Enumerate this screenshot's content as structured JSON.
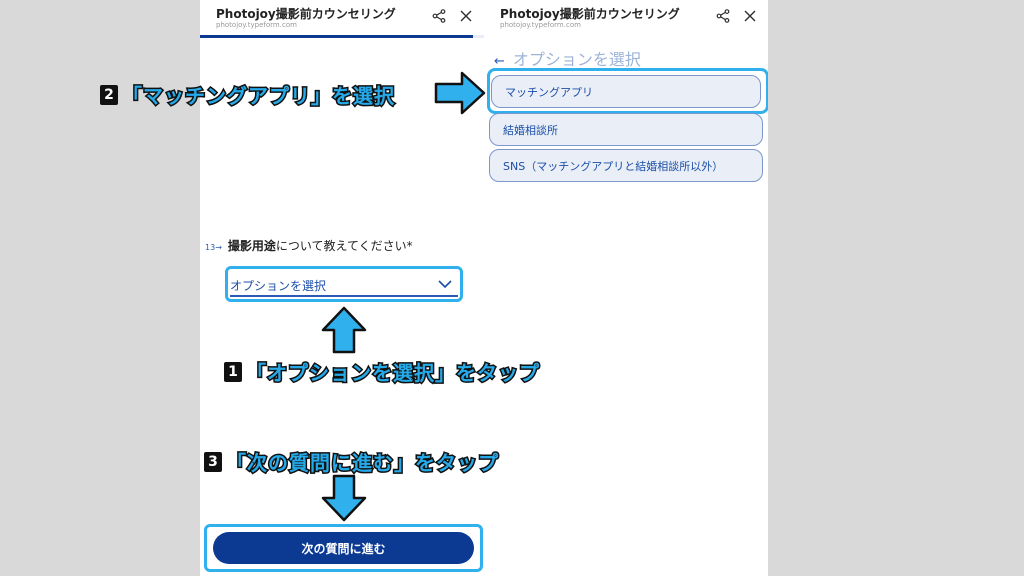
{
  "app": {
    "title": "Photojoy撮影前カウンセリング",
    "url": "photojoy.typeform.com",
    "share_icon": "share-icon",
    "close_icon": "close-icon"
  },
  "left": {
    "progress": 0.96,
    "question": {
      "number": "13",
      "arrow": "→",
      "bold": "撮影用途",
      "rest": "について教えてください*"
    },
    "dropdown": {
      "placeholder": "オプションを選択",
      "icon": "chevron-down-icon"
    },
    "next_button": "次の質問に進む"
  },
  "right": {
    "back_arrow": "←",
    "back_label": "オプションを選択",
    "options": [
      "マッチングアプリ",
      "結婚相談所",
      "SNS（マッチングアプリと結婚相談所以外）"
    ]
  },
  "annotations": {
    "step1": {
      "num": "1",
      "text": "「オプションを選択」をタップ"
    },
    "step2": {
      "num": "2",
      "text": "「マッチングアプリ」を選択"
    },
    "step3": {
      "num": "3",
      "text": "「次の質問に進む」をタップ"
    }
  },
  "colors": {
    "accent": "#30b1ee",
    "brand_navy": "#0c3a93",
    "link_blue": "#1c4fa8",
    "background": "#d9d9d9"
  }
}
